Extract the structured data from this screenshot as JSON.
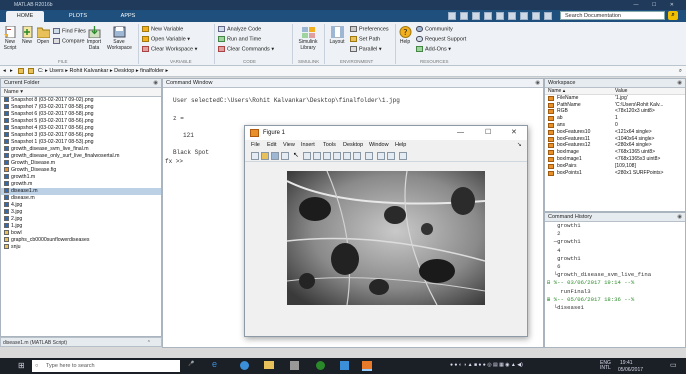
{
  "window": {
    "title": "MATLAB R2016b"
  },
  "tabs": {
    "home": "HOME",
    "plots": "PLOTS",
    "apps": "APPS"
  },
  "search": {
    "placeholder": "Search Documentation"
  },
  "ribbon": {
    "new_script": "New Script",
    "new": "New",
    "open": "Open",
    "find_files": "Find Files",
    "compare": "Compare",
    "import_data": "Import Data",
    "save_workspace": "Save Workspace",
    "new_variable": "New Variable",
    "open_variable": "Open Variable",
    "clear_workspace": "Clear Workspace",
    "analyze_code": "Analyze Code",
    "run_and_time": "Run and Time",
    "clear_commands": "Clear Commands",
    "simulink_library": "Simulink Library",
    "layout": "Layout",
    "preferences": "Preferences",
    "set_path": "Set Path",
    "parallel": "Parallel",
    "help": "Help",
    "community": "Community",
    "request_support": "Request Support",
    "add_ons": "Add-Ons",
    "groups": [
      "FILE",
      "VARIABLE",
      "CODE",
      "SIMULINK",
      "ENVIRONMENT",
      "RESOURCES"
    ]
  },
  "address": {
    "path": "C: ▸ Users ▸ Rohit Kalvankar ▸ Desktop ▸ finalfolder ▸"
  },
  "current_folder": {
    "title": "Current Folder",
    "column": "Name ▾",
    "items": [
      {
        "name": "Snapshot 8 (03-02-2017 09-02).png",
        "type": "png",
        "selected": false
      },
      {
        "name": "Snapshot 7 (03-02-2017 08-58).png",
        "type": "png",
        "selected": false
      },
      {
        "name": "Snapshot 6 (03-02-2017 08-58).png",
        "type": "png",
        "selected": false
      },
      {
        "name": "Snapshot 5 (03-02-2017 08-56).png",
        "type": "png",
        "selected": false
      },
      {
        "name": "Snapshot 4 (03-02-2017 08-56).png",
        "type": "png",
        "selected": false
      },
      {
        "name": "Snapshot 3 (03-02-2017 08-56).png",
        "type": "png",
        "selected": false
      },
      {
        "name": "Snapshot 1 (03-02-2017 08-53).png",
        "type": "png",
        "selected": false
      },
      {
        "name": "growth_disease_svm_live_final.m",
        "type": "m",
        "selected": false
      },
      {
        "name": "growth_disease_only_surf_live_finalwosertal.m",
        "type": "m",
        "selected": false
      },
      {
        "name": "Growth_Disease.m",
        "type": "m",
        "selected": false
      },
      {
        "name": "Growth_Disease.fig",
        "type": "fig",
        "selected": false
      },
      {
        "name": "growth1.m",
        "type": "m",
        "selected": false
      },
      {
        "name": "growth.m",
        "type": "m",
        "selected": false
      },
      {
        "name": "disease1.m",
        "type": "m",
        "selected": true
      },
      {
        "name": "disease.m",
        "type": "m",
        "selected": false
      },
      {
        "name": "4.jpg",
        "type": "jpg",
        "selected": false
      },
      {
        "name": "3.jpg",
        "type": "jpg",
        "selected": false
      },
      {
        "name": "2.jpg",
        "type": "jpg",
        "selected": false
      },
      {
        "name": "1.jpg",
        "type": "jpg",
        "selected": false
      },
      {
        "name": "bowl",
        "type": "folder",
        "selected": false
      },
      {
        "name": "graphs_cb0000sunflowerdiseases",
        "type": "folder",
        "selected": false
      },
      {
        "name": "snju",
        "type": "folder",
        "selected": false
      }
    ],
    "status": "disease1.m (MATLAB Script)"
  },
  "command_window": {
    "title": "Command Window",
    "lines": [
      "User selectedC:\\Users\\Rohit Kalvankar\\Desktop\\finalfolder\\1.jpg",
      "z =",
      "121",
      "Black Spot"
    ],
    "prompt": "fx >>"
  },
  "workspace": {
    "title": "Workspace",
    "col_name": "Name ▴",
    "col_value": "Value",
    "rows": [
      {
        "name": "FileName",
        "value": "'1.jpg'"
      },
      {
        "name": "PathName",
        "value": "'C:\\Users\\Rohit Kalv..."
      },
      {
        "name": "RGB",
        "value": "<78x120x3 uint8>"
      },
      {
        "name": "ab",
        "value": "1"
      },
      {
        "name": "ans",
        "value": "0"
      },
      {
        "name": "boxFeatures10",
        "value": "<121x64 single>"
      },
      {
        "name": "boxFeatures11",
        "value": "<1040x64 single>"
      },
      {
        "name": "boxFeatures12",
        "value": "<280x64 single>"
      },
      {
        "name": "boxImage",
        "value": "<768x1365 uint8>"
      },
      {
        "name": "boxImage1",
        "value": "<768x1365x3 uint8>"
      },
      {
        "name": "boxPairs",
        "value": "[109,108]"
      },
      {
        "name": "boxPoints1",
        "value": "<280x1 SURFPoints>"
      }
    ]
  },
  "command_history": {
    "title": "Command History",
    "lines": [
      "   growth1",
      "   2",
      "  ─growth1",
      "   4",
      "   growth1",
      "   6",
      "  └growth_disease_svm_live_fina",
      "⊟ %-- 03/06/2017 19:14 --%",
      "    runFinal3",
      "⊞ %-- 05/06/2017 18:36 --%",
      "  └disease1"
    ]
  },
  "figure": {
    "title": "Figure 1",
    "menu": [
      "File",
      "Edit",
      "View",
      "Insert",
      "Tools",
      "Desktop",
      "Window",
      "Help"
    ]
  },
  "taskbar": {
    "search": "Type here to search",
    "lang": "ENG\nINTL",
    "time": "19:41",
    "date": "05/06/2017"
  },
  "colors": {
    "accent": "#1f4f7c",
    "selected": "#bcd0e6",
    "figure_bg": "#f0f0f0"
  }
}
